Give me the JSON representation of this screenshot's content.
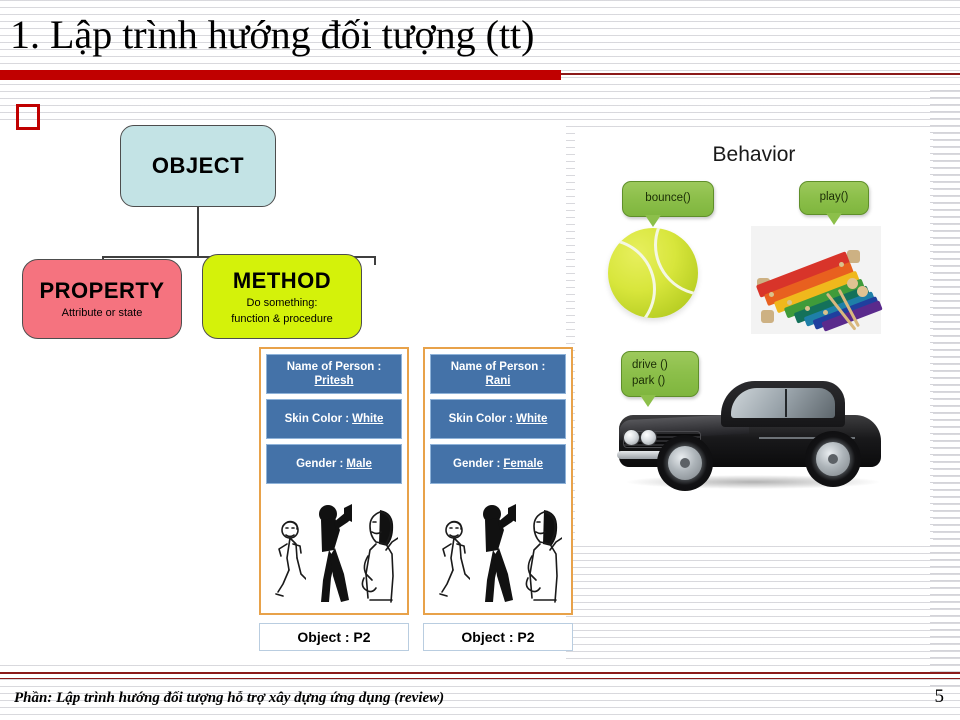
{
  "slide": {
    "title": "1. Lập trình hướng đối tượng (tt)",
    "bullet_marker": "empty-square-bullet",
    "accent_red": "#c00000",
    "rule_dark_red": "#8b1a1a"
  },
  "diagram": {
    "object": {
      "name": "OBJECT",
      "fill": "#c3e3e5"
    },
    "property": {
      "name": "PROPERTY",
      "subtitle": "Attribute or state",
      "fill": "#f5737f"
    },
    "method": {
      "name": "METHOD",
      "subtitle_line1": "Do something:",
      "subtitle_line2": "function & procedure",
      "fill": "#d4f20a"
    }
  },
  "cards": {
    "box_fill": "#4472a8",
    "border": "#e8a24a",
    "items": [
      {
        "attributes": [
          {
            "label": "Name of Person :",
            "value": "Pritesh"
          },
          {
            "label": "Skin Color :",
            "value": "White"
          },
          {
            "label": "Gender :",
            "value": "Male"
          }
        ],
        "object_label": "Object : P2"
      },
      {
        "attributes": [
          {
            "label": "Name of Person :",
            "value": "Rani"
          },
          {
            "label": "Skin Color :",
            "value": "White"
          },
          {
            "label": "Gender :",
            "value": "Female"
          }
        ],
        "object_label": "Object : P2"
      }
    ]
  },
  "behavior": {
    "title": "Behavior",
    "bubble_fill": "#8cbf4a",
    "bubbles": [
      {
        "text": "bounce()",
        "subject": "tennis-ball-image"
      },
      {
        "text": "play()",
        "subject": "xylophone-image"
      },
      {
        "line1": "drive ()",
        "line2": "park ()",
        "subject": "car-image"
      }
    ]
  },
  "footer": {
    "text": "Phần: Lập trình hướng đối tượng hỗ trợ xây dựng ứng dụng (review)",
    "page": "5"
  }
}
